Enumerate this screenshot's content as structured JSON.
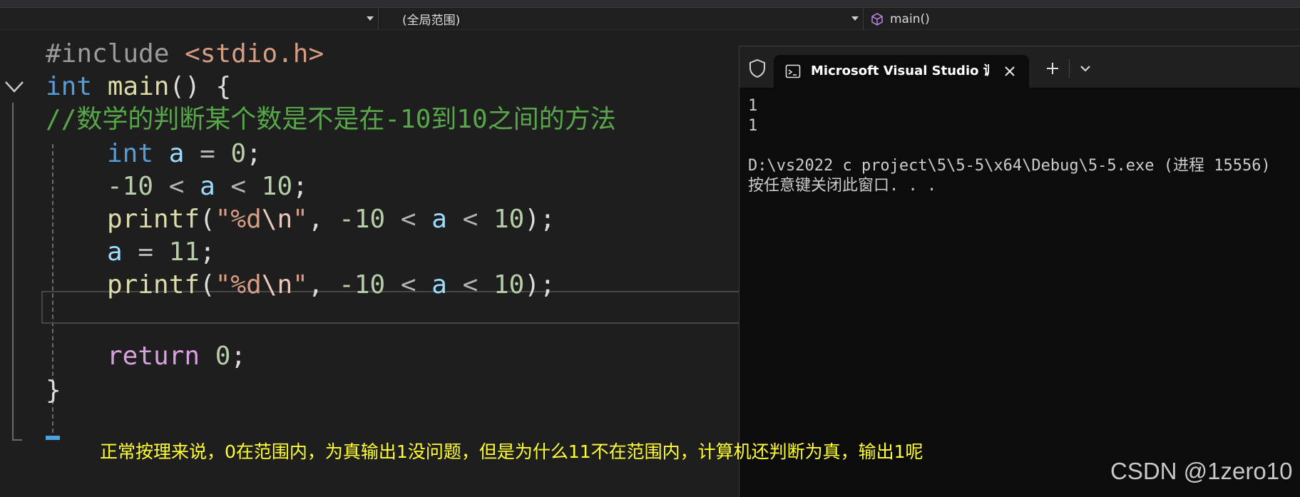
{
  "navbar": {
    "left_dropdown": "",
    "scope_dropdown": "(全局范围)",
    "function_dropdown": "main()"
  },
  "editor": {
    "line1": {
      "pp": "#include",
      "space": " ",
      "header": "<stdio.h>"
    },
    "line2": {
      "type": "int",
      "space": " ",
      "name": "main",
      "rest": "() {"
    },
    "line3": {
      "comment": "//数学的判断某个数是不是在-10到10之间的方法"
    },
    "line4": {
      "type": "int",
      "sp1": " ",
      "var": "a",
      "mid": " = ",
      "num": "0",
      "end": ";"
    },
    "line5": {
      "num1": "-10",
      "op1": " < ",
      "var": "a",
      "op2": " < ",
      "num2": "10",
      "end": ";"
    },
    "line6": {
      "fn": "printf",
      "open": "(",
      "str1": "\"%d",
      "esc": "\\n",
      "str2": "\"",
      "comma": ", ",
      "num1": "-10",
      "op1": " < ",
      "var": "a",
      "op2": " < ",
      "num2": "10",
      "close": ");"
    },
    "line7": {
      "var": "a",
      "mid": " = ",
      "num": "11",
      "end": ";"
    },
    "line8": {
      "fn": "printf",
      "open": "(",
      "str1": "\"%d",
      "esc": "\\n",
      "str2": "\"",
      "comma": ", ",
      "num1": "-10",
      "op1": " < ",
      "var": "a",
      "op2": " < ",
      "num2": "10",
      "close": ");"
    },
    "line10": {
      "kw": "return",
      "sp": " ",
      "num": "0",
      "end": ";"
    },
    "line11": {
      "brace": "}"
    }
  },
  "annotation": "正常按理来说，0在范围内，为真输出1没问题，但是为什么11不在范围内，计算机还判断为真，输出1呢",
  "watermark": "CSDN @1zero10",
  "console": {
    "tab_title": "Microsoft Visual Studio 调试控",
    "lines": [
      "1",
      "1",
      "",
      "D:\\vs2022 c project\\5\\5-5\\x64\\Debug\\5-5.exe (进程 15556)",
      "按任意键关闭此窗口. . ."
    ]
  },
  "colors": {
    "editor_bg": "#1e1e1e",
    "keyword": "#569cd6",
    "comment": "#57a64a",
    "annotation": "#ffff33",
    "console_bg": "#0c0c0c"
  }
}
